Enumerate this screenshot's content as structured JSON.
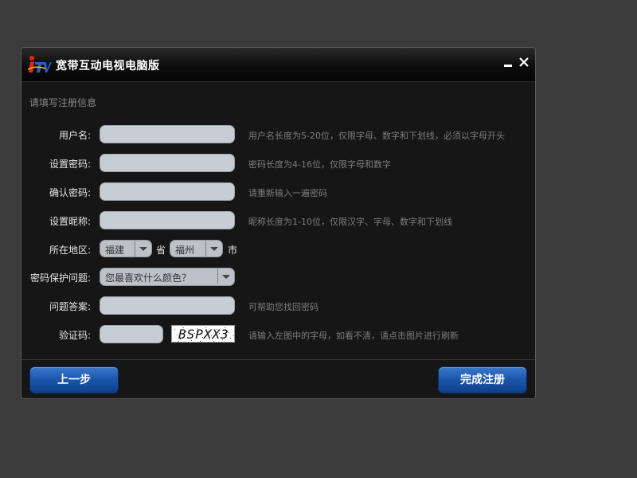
{
  "window": {
    "title": "宽带互动电视电脑版"
  },
  "form": {
    "subtitle": "请填写注册信息",
    "fields": [
      {
        "label": "用户名:",
        "value": "",
        "hint": "用户名长度为5-20位，仅限字母、数字和下划线，必须以字母开头"
      },
      {
        "label": "设置密码:",
        "value": "",
        "hint": "密码长度为4-16位，仅限字母和数字"
      },
      {
        "label": "确认密码:",
        "value": "",
        "hint": "请重新输入一遍密码"
      },
      {
        "label": "设置昵称:",
        "value": "",
        "hint": "昵称长度为1-10位，仅限汉字、字母、数字和下划线"
      }
    ],
    "region": {
      "label": "所在地区:",
      "province": "福建",
      "province_unit": "省",
      "city": "福州",
      "city_unit": "市"
    },
    "security_question": {
      "label": "密码保护问题:",
      "selected": "您最喜欢什么颜色？"
    },
    "answer": {
      "label": "问题答案:",
      "value": "",
      "hint": "可帮助您找回密码"
    },
    "captcha": {
      "label": "验证码:",
      "value": "",
      "image_text": "BSPXX3",
      "hint": "请输入左图中的字母，如看不清，请点击图片进行刷新"
    }
  },
  "buttons": {
    "prev": "上一步",
    "finish": "完成注册"
  },
  "colors": {
    "accent": "#1d58ad",
    "window_bg": "#161616",
    "input_bg": "#c7cdd4",
    "logo_red": "#e8231f",
    "logo_blue": "#2b5fd0"
  },
  "icons": {
    "logo": "itv-logo-icon",
    "minimize": "minimize-icon",
    "close": "close-icon",
    "dropdown": "chevron-down-icon"
  }
}
